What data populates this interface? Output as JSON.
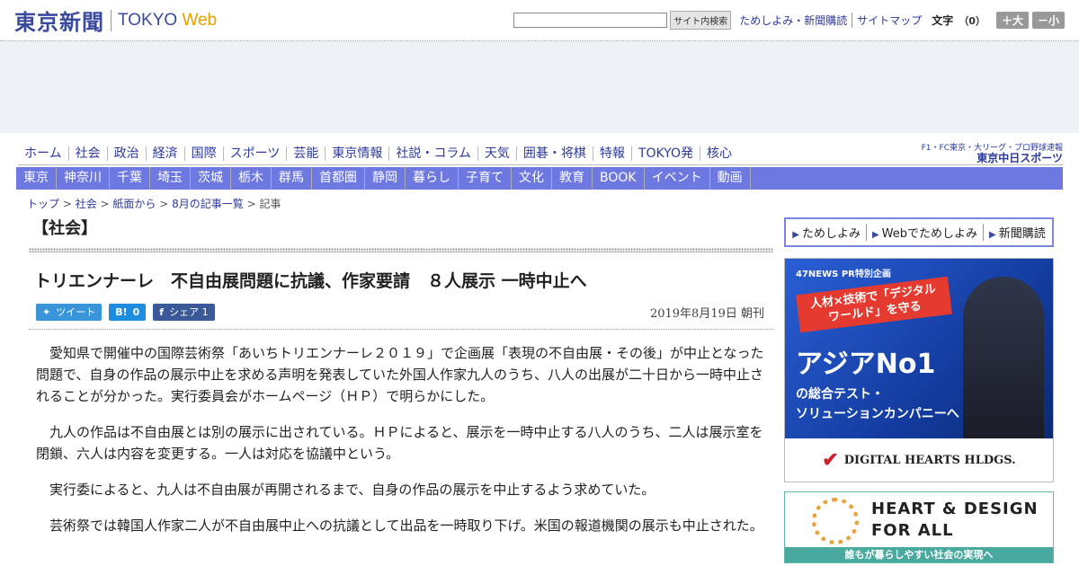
{
  "header": {
    "logo_jp": "東京新聞",
    "logo_en": "TOKYO",
    "logo_web": "Web",
    "search_button": "サイト内検索",
    "links": [
      "ためしよみ・新聞購読",
      "サイトマップ"
    ],
    "font_size_label": "文字",
    "font_size_value": "（0）",
    "font_bigger": "＋大",
    "font_smaller": "－小"
  },
  "nav_primary": [
    "ホーム",
    "社会",
    "政治",
    "経済",
    "国際",
    "スポーツ",
    "芸能",
    "東京情報",
    "社説・コラム",
    "天気",
    "囲碁・将棋",
    "特報",
    "TOKYO発",
    "核心"
  ],
  "promo": {
    "line1": "F1・FC東京・大リーグ・プロ野球速報",
    "line2": "東京中日スポーツ"
  },
  "nav_regional": [
    "東京",
    "神奈川",
    "千葉",
    "埼玉",
    "茨城",
    "栃木",
    "群馬",
    "首都圏",
    "静岡",
    "暮らし",
    "子育て",
    "文化",
    "教育",
    "BOOK",
    "イベント",
    "動画"
  ],
  "breadcrumb": [
    "トップ",
    "社会",
    "紙面から",
    "8月の記事一覧",
    "記事"
  ],
  "article": {
    "section": "【社会】",
    "headline": "トリエンナーレ　不自由展問題に抗議、作家要請　８人展示 一時中止へ",
    "share": {
      "tweet": "ツイート",
      "hatena": "0",
      "fb": "シェア 1"
    },
    "date": "2019年8月19日 朝刊",
    "paragraphs": [
      "愛知県で開催中の国際芸術祭「あいちトリエンナーレ２０１９」で企画展「表現の不自由展・その後」が中止となった問題で、自身の作品の展示中止を求める声明を発表していた外国人作家九人のうち、八人の出展が二十日から一時中止されることが分かった。実行委員会がホームページ（ＨＰ）で明らかにした。",
      "九人の作品は不自由展とは別の展示に出されている。ＨＰによると、展示を一時中止する八人のうち、二人は展示室を閉鎖、六人は内容を変更する。一人は対応を協議中という。",
      "実行委によると、九人は不自由展が再開されるまで、自身の作品の展示を中止するよう求めていた。",
      "芸術祭では韓国人作家二人が不自由展中止への抗議として出品を一時取り下げ。米国の報道機関の展示も中止された。"
    ]
  },
  "sidebar": {
    "subscribe": [
      "ためしよみ",
      "Webでためしよみ",
      "新聞購読"
    ],
    "ad1": {
      "label": "47NEWS PR特別企画",
      "banner": "人材×技術で「デジタルワールド」を守る",
      "big": "アジアNo1",
      "sub1": "の総合テスト・",
      "sub2": "ソリューションカンパニーへ",
      "sponsor": "DIGITAL HEARTS HLDGS."
    },
    "ad2": {
      "line1": "HEART & DESIGN",
      "line2": "FOR ALL",
      "strip": "誰もが暮らしやすい社会の実現へ"
    }
  }
}
